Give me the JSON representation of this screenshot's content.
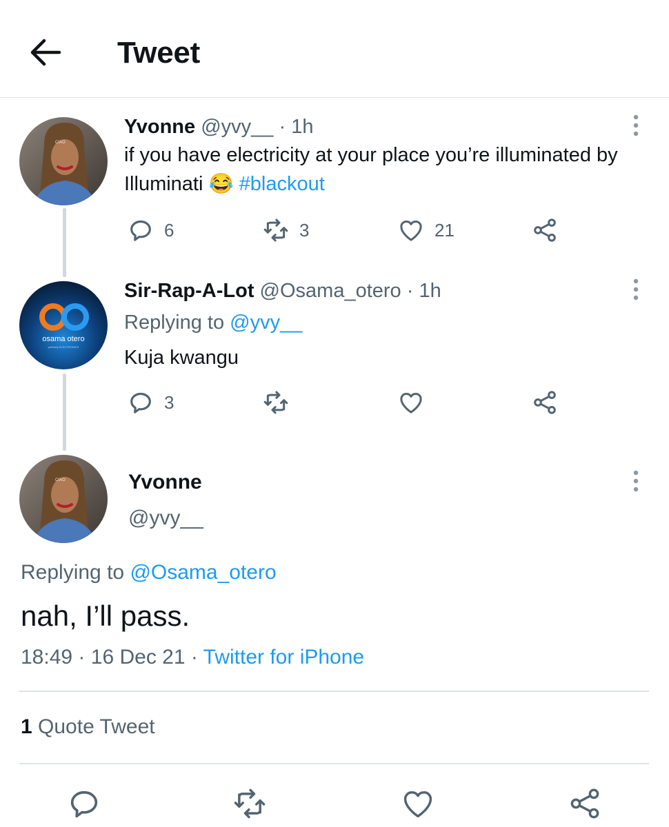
{
  "header": {
    "title": "Tweet",
    "back_icon": "arrow-left-icon"
  },
  "thread": [
    {
      "name": "Yvonne",
      "handle": "@yvy__",
      "sep": "·",
      "time": "1h",
      "text": "if you have electricity at your place you’re illuminated by Illuminati",
      "emoji": "😂",
      "hashtag": "#blackout",
      "replies": "6",
      "retweets": "3",
      "likes": "21"
    },
    {
      "name": "Sir-Rap-A-Lot",
      "handle": "@Osama_otero",
      "sep": "·",
      "time": "1h",
      "replying_label": "Replying to",
      "replying_handle": "@yvy__",
      "text": "Kuja kwangu",
      "replies": "3",
      "retweets": "",
      "likes": "",
      "avatar_text": "osama otero",
      "avatar_subtext": "pertinely ELECTRONICS"
    }
  ],
  "focused": {
    "name": "Yvonne",
    "handle": "@yvy__",
    "replying_label": "Replying to",
    "replying_handle": "@Osama_otero",
    "text": "nah, I’ll pass.",
    "time": "18:49",
    "sep1": "·",
    "date": "16 Dec 21",
    "sep2": "·",
    "source": "Twitter for iPhone"
  },
  "quotes": {
    "count": "1",
    "label": "Quote Tweet"
  },
  "avatar_label": "CIAO",
  "colors": {
    "accent": "#1d9bf0",
    "text": "#0f1419",
    "muted": "#536471",
    "divider": "#dfe3e6"
  }
}
